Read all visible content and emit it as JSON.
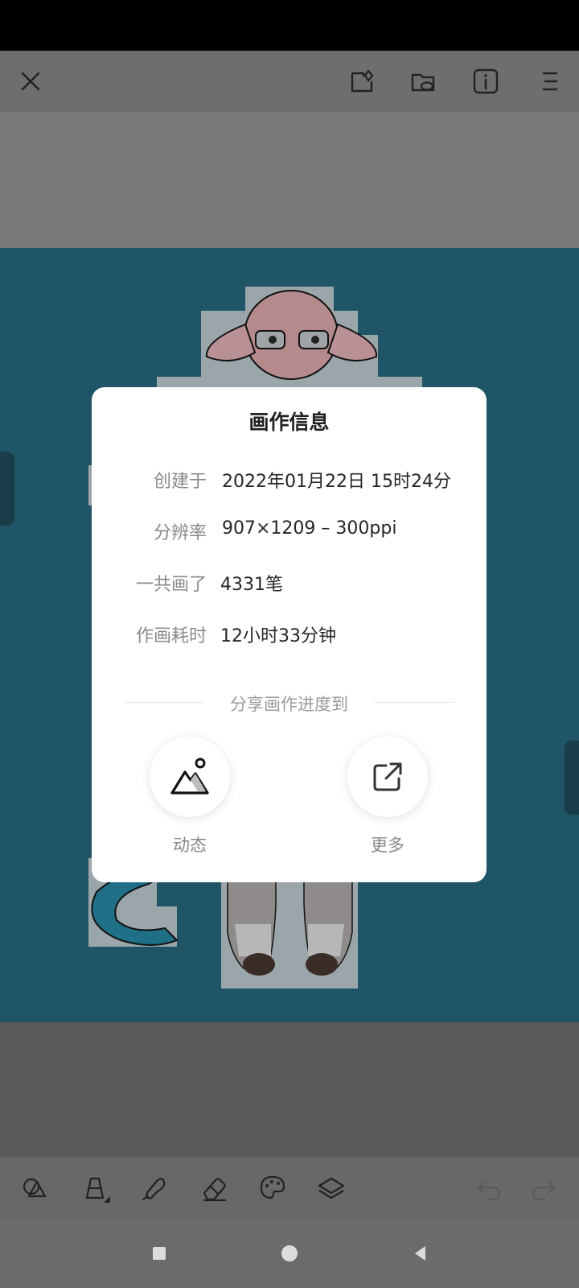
{
  "dialog": {
    "title": "画作信息",
    "rows": [
      {
        "label": "创建于",
        "value": "2022年01月22日 15时24分"
      },
      {
        "label": "分辨率",
        "value": "907×1209 – 300ppi"
      },
      {
        "label": "一共画了",
        "value": "4331笔"
      },
      {
        "label": "作画耗时",
        "value": "12小时33分钟"
      }
    ],
    "share_heading": "分享画作进度到",
    "share_targets": [
      {
        "label": "动态",
        "icon": "mountain-image-icon"
      },
      {
        "label": "更多",
        "icon": "external-share-icon"
      }
    ]
  },
  "topbar": {
    "icons": [
      "close-icon",
      "gallery-icon",
      "cloud-folder-icon",
      "info-icon",
      "menu-icon"
    ]
  },
  "toolbar": {
    "icons": [
      "shapes-icon",
      "bucket-icon",
      "brush-icon",
      "eraser-icon",
      "palette-icon",
      "layers-icon",
      "undo-icon",
      "redo-icon"
    ]
  },
  "colors": {
    "canvas_bg": "#1f5566",
    "dialog_bg": "#ffffff",
    "overlay": "#5a5a5a"
  }
}
